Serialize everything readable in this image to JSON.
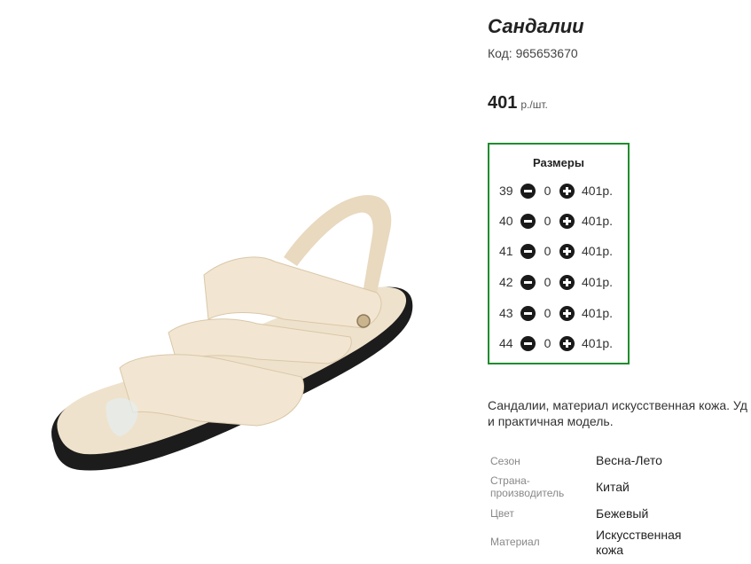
{
  "product": {
    "title": "Сандалии",
    "code": "Код: 965653670",
    "price_value": "401",
    "price_unit": "р./шт."
  },
  "sizes": {
    "title": "Размеры",
    "rows": [
      {
        "size": "39",
        "qty": "0",
        "price": "401р."
      },
      {
        "size": "40",
        "qty": "0",
        "price": "401р."
      },
      {
        "size": "41",
        "qty": "0",
        "price": "401р."
      },
      {
        "size": "42",
        "qty": "0",
        "price": "401р."
      },
      {
        "size": "43",
        "qty": "0",
        "price": "401р."
      },
      {
        "size": "44",
        "qty": "0",
        "price": "401р."
      }
    ]
  },
  "description": {
    "line1": "Сандалии, материал искусственная кожа. Уд",
    "line2": "и практичная модель."
  },
  "properties": [
    {
      "label": "Сезон",
      "value": "Весна-Лето"
    },
    {
      "label": "Страна-производитель",
      "value": "Китай"
    },
    {
      "label": "Цвет",
      "value": "Бежевый"
    },
    {
      "label": "Материал",
      "value": "Искусственная кожа"
    }
  ],
  "colors": {
    "sizes_border": "#1f8c2c",
    "sandal_beige": "#efe2cc",
    "sole": "#1c1c1c"
  }
}
